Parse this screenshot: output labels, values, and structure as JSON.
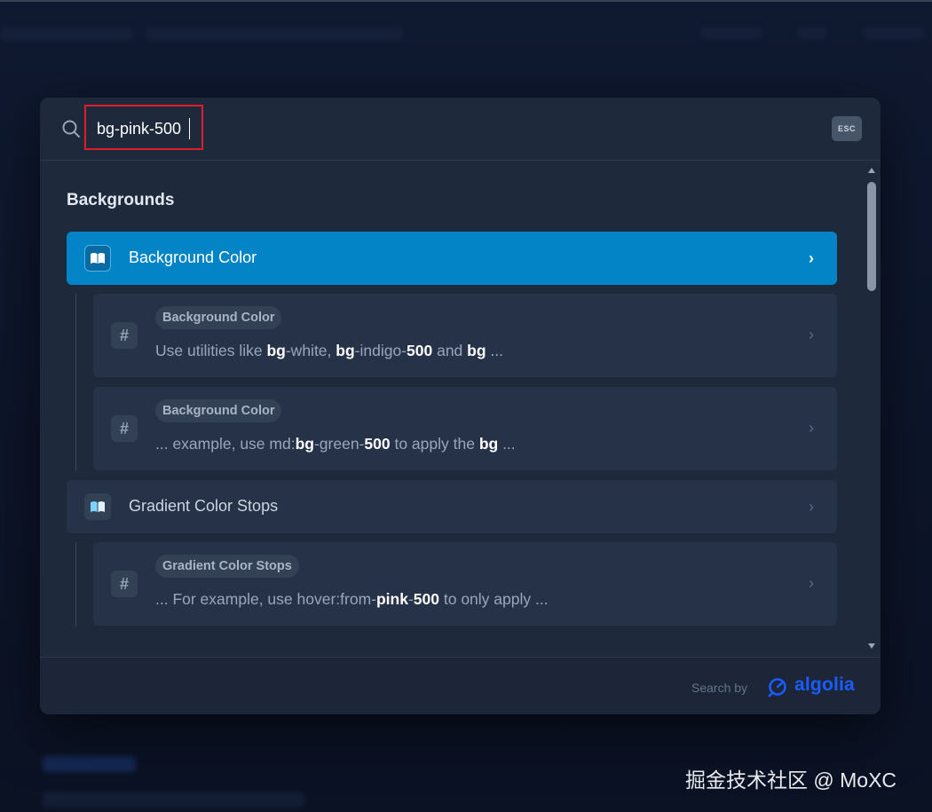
{
  "search": {
    "value": "bg-pink-500",
    "esc_label": "ESC"
  },
  "section": {
    "title": "Backgrounds"
  },
  "results": [
    {
      "title": "Background Color"
    },
    {
      "title": "Gradient Color Stops"
    }
  ],
  "sub_results": [
    {
      "badge": "Background Color",
      "parts": [
        {
          "t": "Use utilities like ",
          "b": false
        },
        {
          "t": "bg",
          "b": true
        },
        {
          "t": "-white, ",
          "b": false
        },
        {
          "t": "bg",
          "b": true
        },
        {
          "t": "-indigo-",
          "b": false
        },
        {
          "t": "500",
          "b": true
        },
        {
          "t": " and ",
          "b": false
        },
        {
          "t": "bg",
          "b": true
        },
        {
          "t": " ...",
          "b": false
        }
      ]
    },
    {
      "badge": "Background Color",
      "parts": [
        {
          "t": "... example, use md:",
          "b": false
        },
        {
          "t": "bg",
          "b": true
        },
        {
          "t": "-green-",
          "b": false
        },
        {
          "t": "500",
          "b": true
        },
        {
          "t": " to apply the ",
          "b": false
        },
        {
          "t": "bg",
          "b": true
        },
        {
          "t": " ...",
          "b": false
        }
      ]
    },
    {
      "badge": "Gradient Color Stops",
      "parts": [
        {
          "t": "... For example, use hover:from-",
          "b": false
        },
        {
          "t": "pink",
          "b": true
        },
        {
          "t": "-",
          "b": false
        },
        {
          "t": "500",
          "b": true
        },
        {
          "t": " to only apply ...",
          "b": false
        }
      ]
    }
  ],
  "footer": {
    "search_by": "Search by",
    "brand": "algolia"
  },
  "watermark": "掘金技术社区 @ MoXC",
  "colors": {
    "active": "#0284c7",
    "panel": "#1e293b",
    "brand": "#1a5cff",
    "highlight": "#e11d2a"
  }
}
